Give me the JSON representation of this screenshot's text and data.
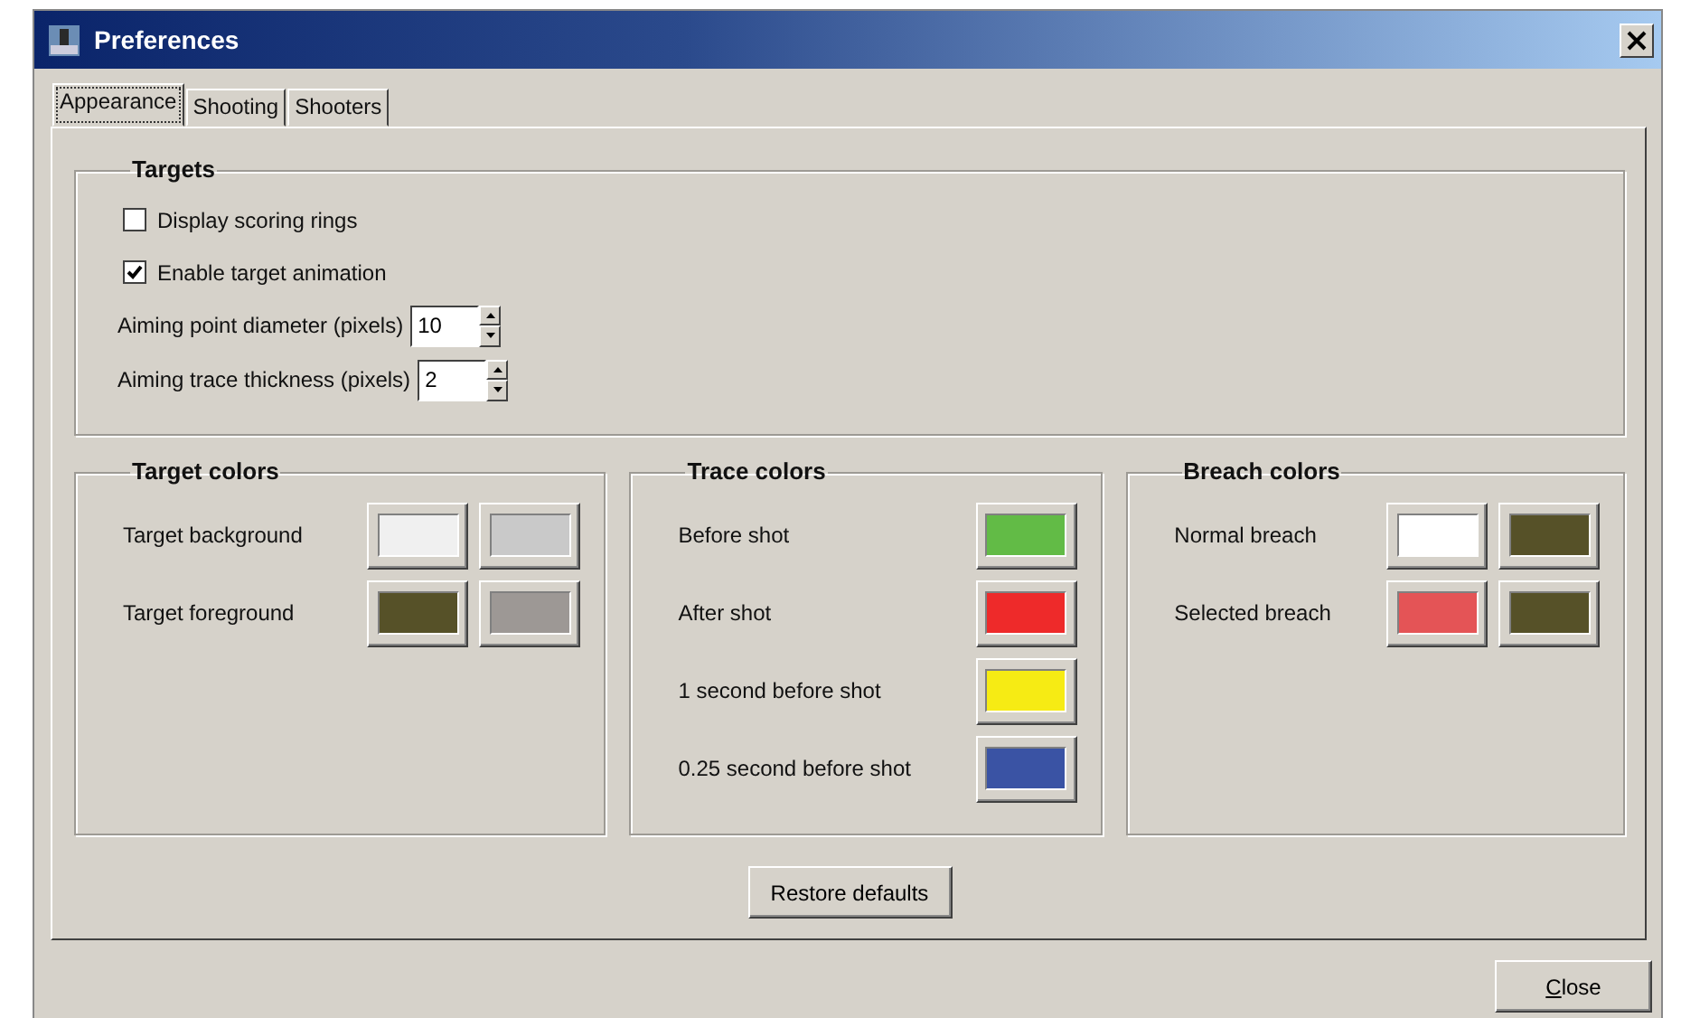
{
  "window": {
    "title": "Preferences"
  },
  "tabs": [
    {
      "label": "Appearance",
      "selected": true
    },
    {
      "label": "Shooting",
      "selected": false
    },
    {
      "label": "Shooters",
      "selected": false
    }
  ],
  "targets": {
    "title": "Targets",
    "options": [
      {
        "kind": "checkbox",
        "label": "Display scoring rings",
        "checked": false
      },
      {
        "kind": "checkbox",
        "label": "Enable target animation",
        "checked": true
      },
      {
        "kind": "spin",
        "label": "Aiming point diameter (pixels)",
        "value": "10"
      },
      {
        "kind": "spin",
        "label": "Aiming trace thickness (pixels)",
        "value": "2"
      }
    ]
  },
  "color_groups": [
    {
      "title": "Target colors",
      "rows": [
        {
          "label": "Target background",
          "swatches": [
            {
              "color": "#f0f0f0"
            },
            {
              "color": "#c9c9c9"
            }
          ]
        },
        {
          "label": "Target foreground",
          "swatches": [
            {
              "color": "#565128"
            },
            {
              "color": "#9d9895"
            }
          ]
        }
      ]
    },
    {
      "title": "Trace colors",
      "rows": [
        {
          "label": "Before shot",
          "swatches": [
            {
              "color": "#62bb46"
            }
          ]
        },
        {
          "label": "After shot",
          "swatches": [
            {
              "color": "#ee2a2a"
            }
          ]
        },
        {
          "label": "1 second before shot",
          "swatches": [
            {
              "color": "#f6eb14"
            }
          ]
        },
        {
          "label": "0.25 second before shot",
          "swatches": [
            {
              "color": "#3a53a4"
            }
          ]
        }
      ]
    },
    {
      "title": "Breach colors",
      "rows": [
        {
          "label": "Normal breach",
          "swatches": [
            {
              "color": "#ffffff"
            },
            {
              "color": "#565128"
            }
          ]
        },
        {
          "label": "Selected breach",
          "swatches": [
            {
              "color": "#e45456"
            },
            {
              "color": "#565128"
            }
          ]
        }
      ]
    }
  ],
  "restore_button": "Restore defaults",
  "close_button": {
    "label": "Close",
    "mnemonic_underlined": true
  }
}
